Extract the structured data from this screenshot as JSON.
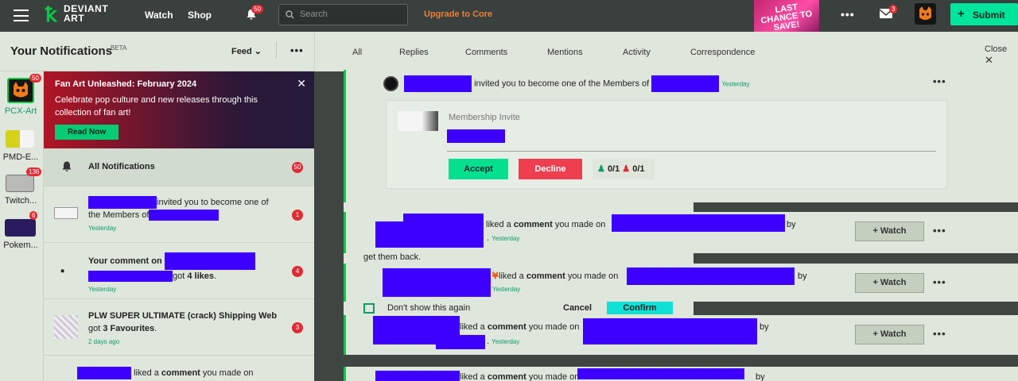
{
  "topbar": {
    "logo_line1": "DEVIANT",
    "logo_line2": "ART",
    "watch": "Watch",
    "shop": "Shop",
    "bell_badge": "50",
    "search_placeholder": "Search",
    "upgrade": "Upgrade to Core",
    "promo_line1": "LAST",
    "promo_line2": "CHANCE TO",
    "promo_line3": "SAVE!",
    "more": "•••",
    "mail_badge": "3",
    "submit": "Submit"
  },
  "left_header": {
    "title": "Your Notifications",
    "beta": "BETA",
    "feed": "Feed",
    "more": "•••"
  },
  "groups": [
    {
      "label": "PCX-Art",
      "badge": "50"
    },
    {
      "label": "PMD-E...",
      "badge": ""
    },
    {
      "label": "Twitch...",
      "badge": "136"
    },
    {
      "label": "Pokem...",
      "badge": "6"
    }
  ],
  "banner": {
    "title": "Fan Art Unleashed: February 2024",
    "body": "Celebrate pop culture and new releases through this collection of fan art!",
    "cta": "Read Now",
    "close": "✕"
  },
  "list": {
    "all_label": "All Notifications",
    "all_count": "50",
    "items": [
      {
        "text1": "invited you to become one of",
        "text2": "the Members of",
        "time": "Yesterday",
        "count": "1"
      },
      {
        "prefix": "Your comment on ",
        "got": "got ",
        "likes": "4 likes",
        "suffix": ".",
        "time": "Yesterday",
        "count": "4"
      },
      {
        "title": "PLW SUPER ULTIMATE (crack) Shipping Web",
        "got": "got ",
        "favs": "3 Favourites",
        "suffix": ".",
        "time": "2 days ago",
        "count": "3"
      },
      {
        "text": "liked a ",
        "bold": "comment",
        "rest": " you made on"
      }
    ]
  },
  "tabs": [
    "All",
    "Replies",
    "Comments",
    "Mentions",
    "Activity",
    "Correspondence"
  ],
  "close_label": "Close",
  "invite_card": {
    "text": "invited you to become one of the Members of",
    "time": "Yesterday",
    "sub_title": "Membership Invite",
    "accept": "Accept",
    "decline": "Decline",
    "vote_yes": "0/1",
    "vote_no": "0/1"
  },
  "like_cards": [
    {
      "pre": "liked a ",
      "bold": "comment",
      "mid": " you made on",
      "by": "by",
      "time": "Yesterday",
      "watch": "+ Watch"
    },
    {
      "pre": "liked a ",
      "bold": "comment",
      "mid": " you made on ",
      "by": "by",
      "time": "Yesterday",
      "watch": "+ Watch"
    },
    {
      "pre": "liked a ",
      "bold": "comment",
      "mid": " you made on",
      "by": "by",
      "time": "Yesterday",
      "watch": "+ Watch"
    },
    {
      "pre": "liked a ",
      "bold": "comment",
      "mid": " you made on",
      "by": "by"
    }
  ],
  "strip_text": "get them back.",
  "confirm_strip": {
    "label": "Don't show this again",
    "cancel": "Cancel",
    "confirm": "Confirm"
  },
  "colors": {
    "accent_green": "#05cc47",
    "redaction": "#3d00ff",
    "badge_red": "#e12b34",
    "core_orange": "#f17c35"
  }
}
